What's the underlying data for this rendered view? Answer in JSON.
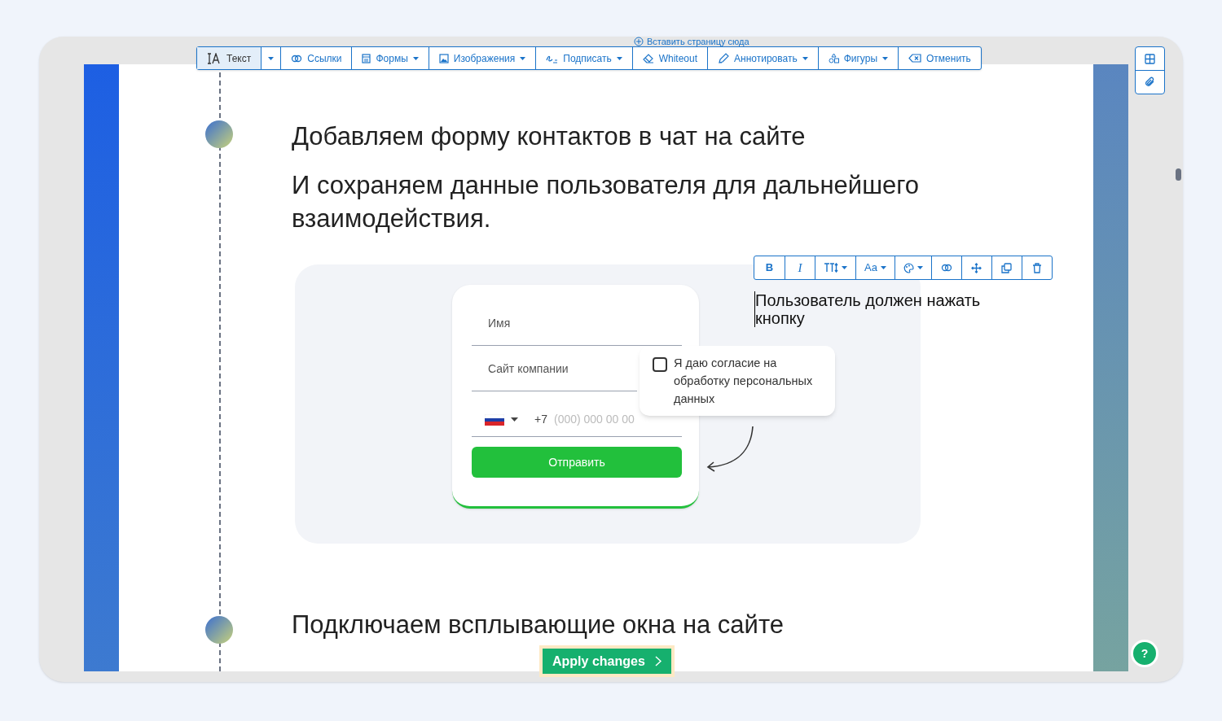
{
  "top_strip": {
    "label": "Вставить страницу сюда"
  },
  "toolbar": [
    {
      "kind": "tool",
      "label": "Текст",
      "dropdown": false,
      "selected": true
    },
    {
      "kind": "caret",
      "selected": false
    },
    {
      "kind": "tool",
      "label": "Ссылки",
      "dropdown": false,
      "selected": false
    },
    {
      "kind": "tool",
      "label": "Формы",
      "dropdown": true,
      "selected": false
    },
    {
      "kind": "tool",
      "label": "Изображения",
      "dropdown": true,
      "selected": false
    },
    {
      "kind": "tool",
      "label": "Подписать",
      "dropdown": true,
      "selected": false
    },
    {
      "kind": "tool",
      "label": "Whiteout",
      "dropdown": false,
      "selected": false
    },
    {
      "kind": "tool",
      "label": "Аннотировать",
      "dropdown": true,
      "selected": false
    },
    {
      "kind": "tool",
      "label": "Фигуры",
      "dropdown": true,
      "selected": false
    },
    {
      "kind": "tool",
      "label": "Отменить",
      "dropdown": false,
      "selected": false
    }
  ],
  "headings": [
    "Добавляем форму контактов в чат на сайте",
    "И сохраняем данные пользователя для дальнейшего взаимодействия."
  ],
  "form": {
    "fields": [
      {
        "kind": "text",
        "placeholder": "Имя"
      },
      {
        "kind": "text",
        "placeholder": "Сайт компании"
      },
      {
        "kind": "phone",
        "prefix": "+7",
        "placeholder": "(000) 000 00 00"
      }
    ],
    "submit": "Отправить",
    "consent": {
      "label": "Я даю согласие на обработку персональных данных",
      "checked": false
    }
  },
  "text_toolbar": [
    {
      "kind": "text",
      "label": "B",
      "dropdown": false
    },
    {
      "kind": "text",
      "label": "I",
      "dropdown": false
    },
    {
      "kind": "size",
      "dropdown": true
    },
    {
      "kind": "text",
      "label": "Aa",
      "dropdown": true
    },
    {
      "kind": "palette",
      "dropdown": true
    },
    {
      "kind": "link",
      "dropdown": false
    },
    {
      "kind": "move",
      "dropdown": false
    },
    {
      "kind": "copy",
      "dropdown": false
    },
    {
      "kind": "delete",
      "dropdown": false
    }
  ],
  "note": "Пользователь должен нажать кнопку",
  "next_heading": "Подключаем всплывающие окна на сайте",
  "apply_button": "Apply changes",
  "help_button": "?"
}
